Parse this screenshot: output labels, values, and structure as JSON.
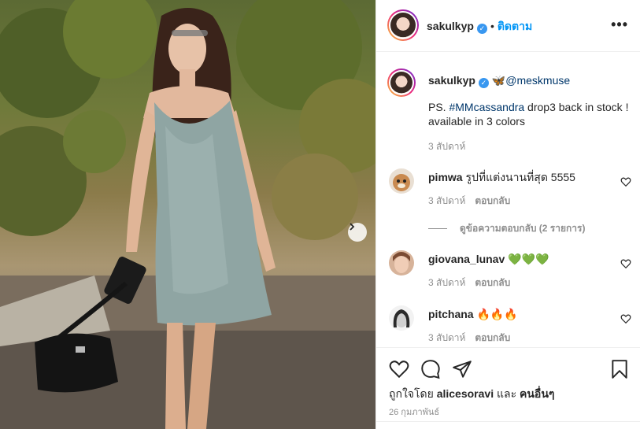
{
  "header": {
    "username": "sakulkyp",
    "follow_label": "ติดตาม",
    "separator": "•",
    "more_icon": "more-options-icon"
  },
  "caption": {
    "username": "sakulkyp",
    "mention": "🦋@meskmuse",
    "text_prefix": "PS. ",
    "hashtag": "#MMcassandra",
    "text_suffix": " drop3 back in stock ! available in 3 colors",
    "time": "3 สัปดาห์"
  },
  "comments": [
    {
      "username": "pimwa",
      "text": "รูปที่แต่งนานที่สุด 5555",
      "time": "3 สัปดาห์",
      "reply_label": "ตอบกลับ"
    },
    {
      "username": "giovana_lunav",
      "text": "💚💚💚",
      "time": "3 สัปดาห์",
      "reply_label": "ตอบกลับ"
    },
    {
      "username": "pitchana",
      "text": "🔥🔥🔥",
      "time": "3 สัปดาห์",
      "reply_label": "ตอบกลับ"
    }
  ],
  "view_replies": "ดูข้อความตอบกลับ (2 รายการ)",
  "likes": {
    "prefix": "ถูกใจโดย ",
    "user": "alicesoravi",
    "middle": " และ ",
    "others": "คนอื่นๆ"
  },
  "post_date": "26 กุมภาพันธ์",
  "colors": {
    "follow_blue": "#0095f6",
    "meta_gray": "#8e8e8e",
    "link_navy": "#00376b"
  }
}
